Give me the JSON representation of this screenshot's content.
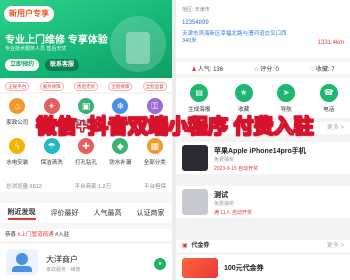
{
  "left": {
    "banner": {
      "new_user_tag": "新用户专享",
      "slogan": "专业上门维修 专享体验",
      "subslogan": "专业技术服务人员 售后无忧",
      "book_button": "立即预约",
      "contact_button": "联系客服"
    },
    "pills": [
      "正规平台",
      "服务保障",
      "售后无忧",
      "全程保障",
      "全程监督"
    ],
    "services": [
      {
        "label": "家政公司",
        "icon": "home-icon",
        "color": "#f39a2e",
        "glyph": "⌂"
      },
      {
        "label": "家庭保洁",
        "icon": "broom-icon",
        "color": "#e85d5d",
        "glyph": "✦"
      },
      {
        "label": "家电维修",
        "icon": "tv-icon",
        "color": "#3bb273",
        "glyph": "▣"
      },
      {
        "label": "空调维修",
        "icon": "aircon-icon",
        "color": "#4a90e2",
        "glyph": "❄"
      },
      {
        "label": "开锁换锁",
        "icon": "lock-icon",
        "color": "#9b6bd6",
        "glyph": "⚿"
      },
      {
        "label": "水电安装",
        "icon": "bolt-icon",
        "color": "#f4b400",
        "glyph": "ϟ"
      },
      {
        "label": "保洁清洗",
        "icon": "clean-icon",
        "color": "#26b6c9",
        "glyph": "☂"
      },
      {
        "label": "打孔钻孔",
        "icon": "drill-icon",
        "color": "#e85d5d",
        "glyph": "✚"
      },
      {
        "label": "防水补漏",
        "icon": "drop-icon",
        "color": "#3bb273",
        "glyph": "◆"
      },
      {
        "label": "全部分类",
        "icon": "grid-icon",
        "color": "#f39a2e",
        "glyph": "▦"
      }
    ],
    "stats": {
      "visits": "总浏览量:6812",
      "merchants": "平台商家:1.2万",
      "guarantee": "平台担保"
    },
    "tabs": [
      "附近发现",
      "评价最好",
      "人气最高",
      "认证商家"
    ],
    "ad_bar": {
      "prefix": "恭喜",
      "highlight": "#上门管道疏通",
      "suffix": "#入驻"
    },
    "merchant": {
      "name": "大洋商户",
      "sub": "家政服务 · 维修"
    }
  },
  "right": {
    "info": {
      "region": "地区: 天津市",
      "phone": "12354899",
      "address": "天津市滨海新区幸福北路与漕河道交叉口西340米",
      "distance": "1331.4km"
    },
    "counts": {
      "popularity": "人气: 136",
      "rating": "评分: 0",
      "favorites": "收藏: 7"
    },
    "actions": [
      {
        "label": "生成海报",
        "icon": "poster-icon",
        "glyph": "▤"
      },
      {
        "label": "收藏",
        "icon": "star-icon",
        "glyph": "★"
      },
      {
        "label": "导航",
        "icon": "navigate-icon",
        "glyph": "➤"
      },
      {
        "label": "电话",
        "icon": "phone-icon",
        "glyph": "☎"
      }
    ],
    "lottery_section": {
      "title": "抽奖",
      "more": "更多 >"
    },
    "products": [
      {
        "name": "苹果Apple iPhone14pro手机",
        "price": "免费抽奖",
        "meta": "2023-9-15 自动开奖",
        "color": "#2b2b33"
      },
      {
        "name": "测试",
        "price": "免费抽奖",
        "meta": "满 11人 自动开奖",
        "color": "#c9c9d1"
      }
    ],
    "voucher_section": {
      "title": "代金券",
      "more": "更多 >"
    },
    "coupon": {
      "title": "100元代金券"
    }
  },
  "overlay_text": "微信+抖音双端小程序 付费入驻"
}
